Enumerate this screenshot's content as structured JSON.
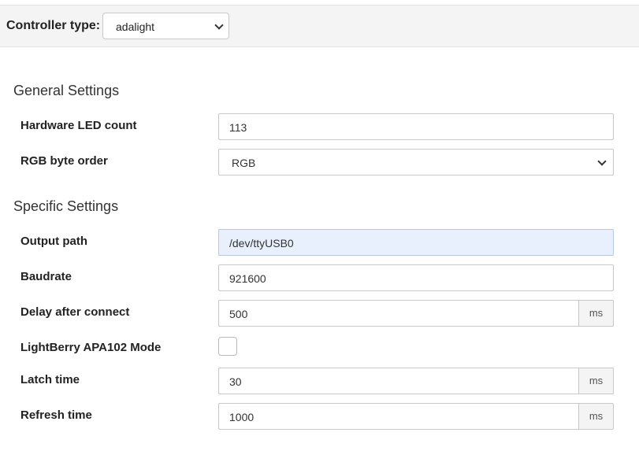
{
  "controller": {
    "label": "Controller type:",
    "selected": "adalight"
  },
  "general": {
    "title": "General Settings",
    "led_count_label": "Hardware LED count",
    "led_count_value": "113",
    "byte_order_label": "RGB byte order",
    "byte_order_value": "RGB"
  },
  "specific": {
    "title": "Specific Settings",
    "output_path_label": "Output path",
    "output_path_value": "/dev/ttyUSB0",
    "baudrate_label": "Baudrate",
    "baudrate_value": "921600",
    "delay_label": "Delay after connect",
    "delay_value": "500",
    "delay_unit": "ms",
    "apa102_label": "LightBerry APA102 Mode",
    "apa102_checked": false,
    "latch_label": "Latch time",
    "latch_value": "30",
    "latch_unit": "ms",
    "refresh_label": "Refresh time",
    "refresh_value": "1000",
    "refresh_unit": "ms"
  },
  "colors": {
    "focused_input_bg": "#e8f0fe",
    "header_bg": "#f4f4f4"
  }
}
